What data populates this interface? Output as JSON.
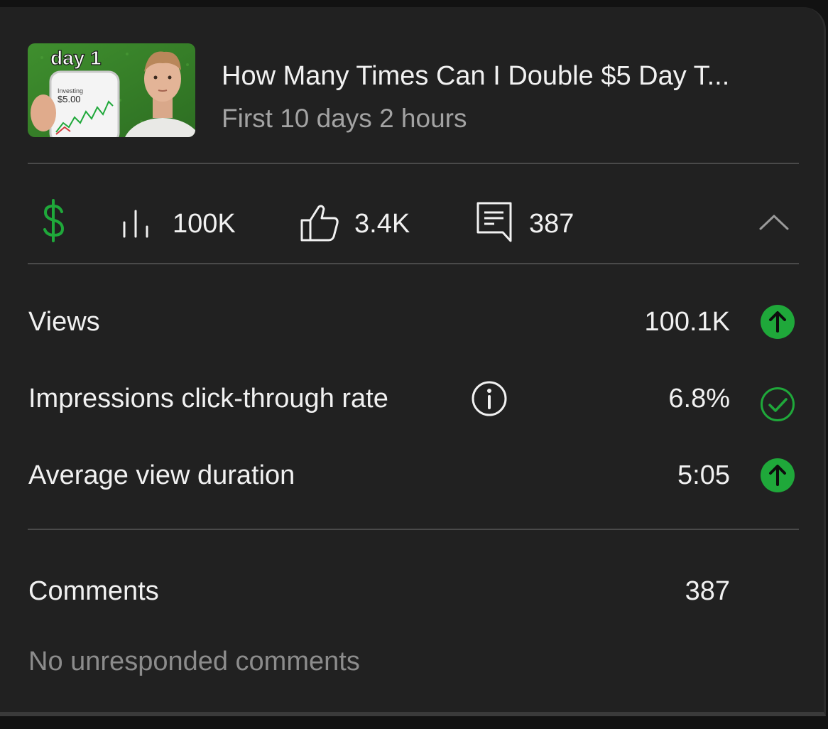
{
  "video": {
    "title": "How Many Times Can I Double $5 Day T...",
    "subtitle": "First 10 days 2 hours",
    "thumbnail": {
      "badge": "day 1",
      "phone_label": "Investing",
      "phone_amount": "$5.00"
    }
  },
  "stats": {
    "views": "100K",
    "likes": "3.4K",
    "comments": "387"
  },
  "metrics": [
    {
      "label": "Views",
      "value": "100.1K",
      "status": "up-arrow-icon"
    },
    {
      "label": "Impressions click-through rate",
      "value": "6.8%",
      "status": "check-circle-icon"
    },
    {
      "label": "Average view duration",
      "value": "5:05",
      "status": "up-arrow-icon"
    }
  ],
  "comments_section": {
    "label": "Comments",
    "value": "387",
    "note": "No unresponded comments"
  },
  "colors": {
    "accent_green": "#1fa83a",
    "background": "#212121",
    "text": "#f1f1f1",
    "muted_text": "#a3a3a3"
  }
}
